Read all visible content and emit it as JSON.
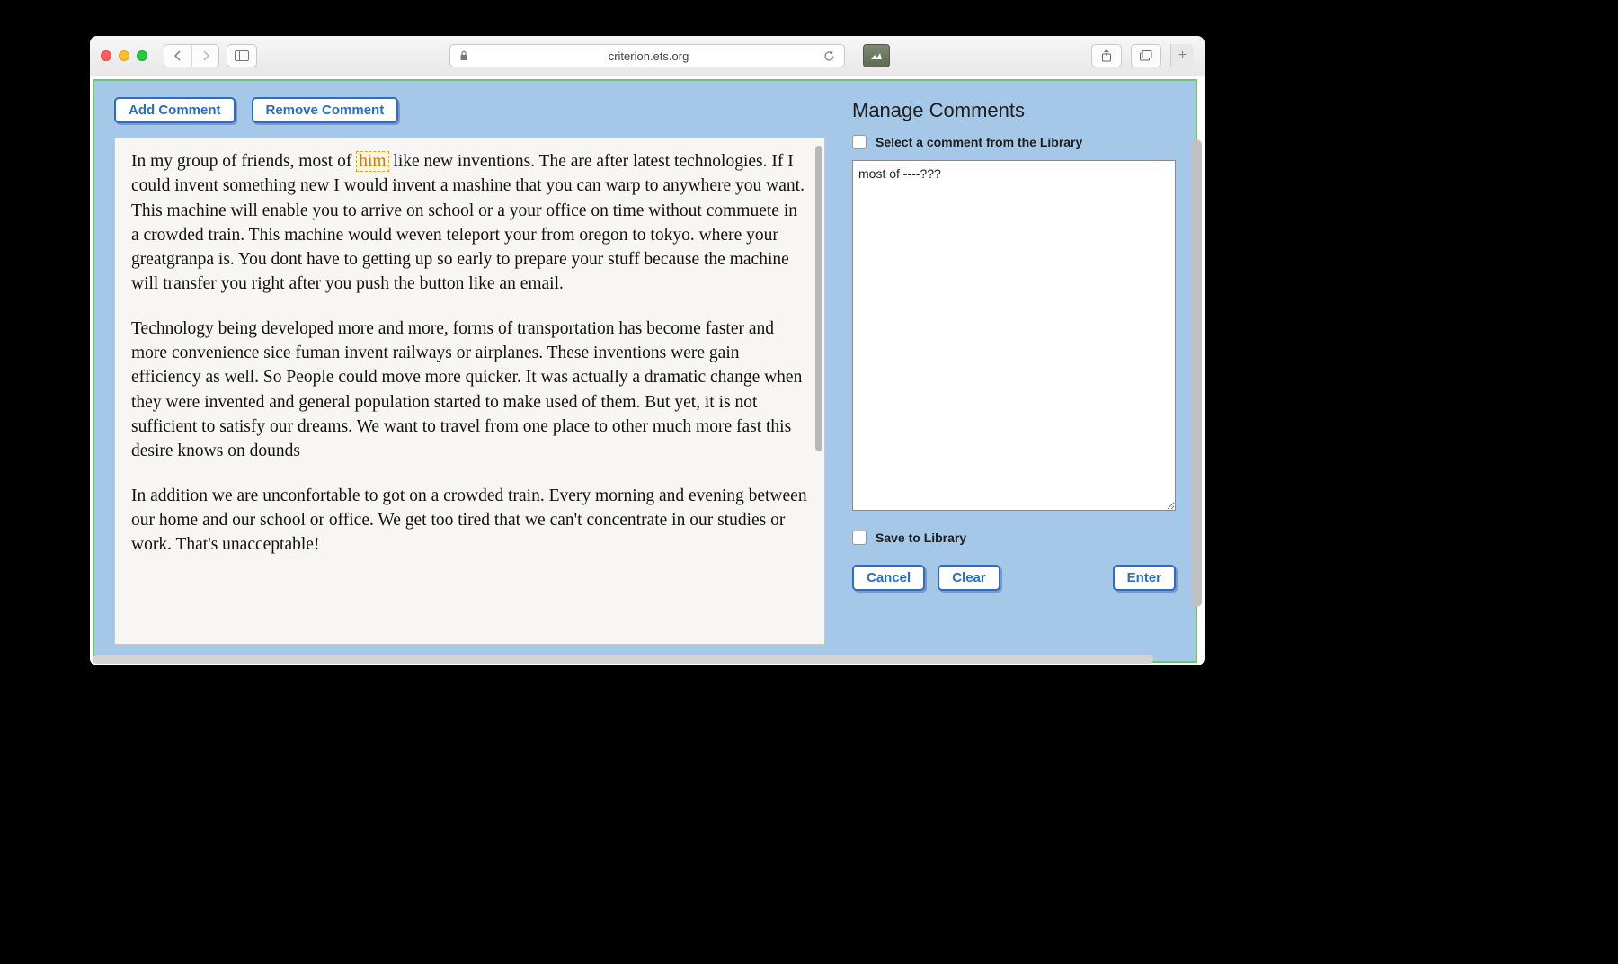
{
  "browser": {
    "url_display": "criterion.ets.org"
  },
  "toolbar": {
    "add_comment_label": "Add Comment",
    "remove_comment_label": "Remove Comment"
  },
  "essay": {
    "p1_before_hl": "In my group of friends, most of ",
    "hl_word": "him",
    "p1_after_hl": " like new inventions. The are after latest technologies. If I could invent something new I would invent a mashine that you can warp to anywhere you want. This machine will enable you to arrive on school or a your office on time without commuete in a crowded train. This machine would weven teleport your from oregon to tokyo. where your greatgranpa is. You dont have to getting up so early to prepare your stuff because the machine will transfer you right after you push the button like an email.",
    "p2": "Technology being developed more and more, forms of transportation has become faster and more convenience sice fuman invent railways or airplanes. These inventions were gain efficiency as well. So People could move more quicker. It was actually a dramatic change when they were invented and general population started to make used of them. But yet, it is not sufficient to satisfy our dreams. We want to travel from one place to other much more fast this desire knows on dounds",
    "p3": "In addition we are unconfortable to got on a crowded train. Every morning and evening between our home and our school or office. We get too tired that we can't concentrate in our studies or work. That's unacceptable!"
  },
  "panel": {
    "title": "Manage Comments",
    "select_from_library_label": "Select a comment from the Library",
    "comment_text": "most of ----???",
    "save_to_library_label": "Save to Library",
    "cancel_label": "Cancel",
    "clear_label": "Clear",
    "enter_label": "Enter"
  }
}
